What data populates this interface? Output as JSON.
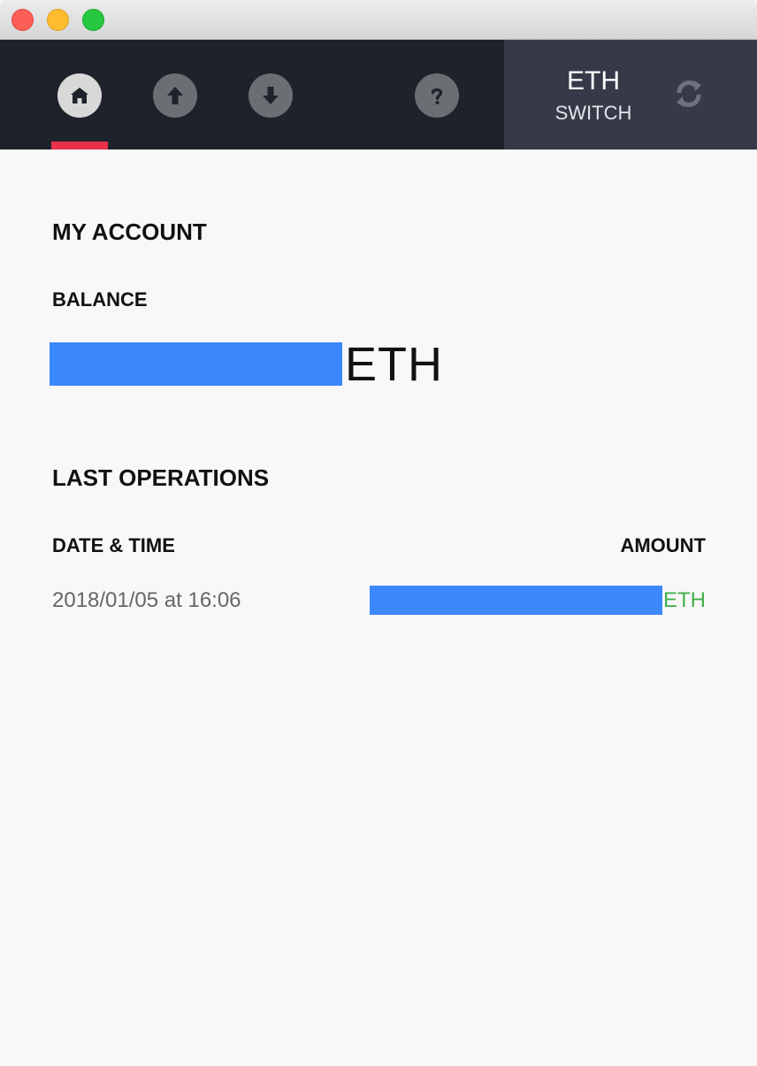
{
  "window": {
    "controls": [
      "close",
      "minimize",
      "maximize"
    ]
  },
  "nav": {
    "items": [
      {
        "name": "home",
        "icon": "home-icon",
        "active": true
      },
      {
        "name": "send",
        "icon": "arrow-up-icon",
        "active": false
      },
      {
        "name": "receive",
        "icon": "arrow-down-icon",
        "active": false
      },
      {
        "name": "help",
        "icon": "question-icon",
        "active": false
      }
    ],
    "active_color": "#e8314a"
  },
  "switch": {
    "currency": "ETH",
    "label": "SWITCH",
    "icon": "refresh-icon"
  },
  "account": {
    "title": "MY ACCOUNT",
    "balance_label": "BALANCE",
    "balance_value": "",
    "balance_unit": "ETH"
  },
  "operations": {
    "title": "LAST OPERATIONS",
    "columns": [
      "DATE & TIME",
      "AMOUNT"
    ],
    "rows": [
      {
        "date": "2018/01/05 at 16:06",
        "amount": "",
        "unit": "ETH"
      }
    ],
    "amount_color": "#42b14e"
  },
  "colors": {
    "redaction": "#3a88fb",
    "header_bg": "#1e222b",
    "switch_bg": "#363a48"
  }
}
